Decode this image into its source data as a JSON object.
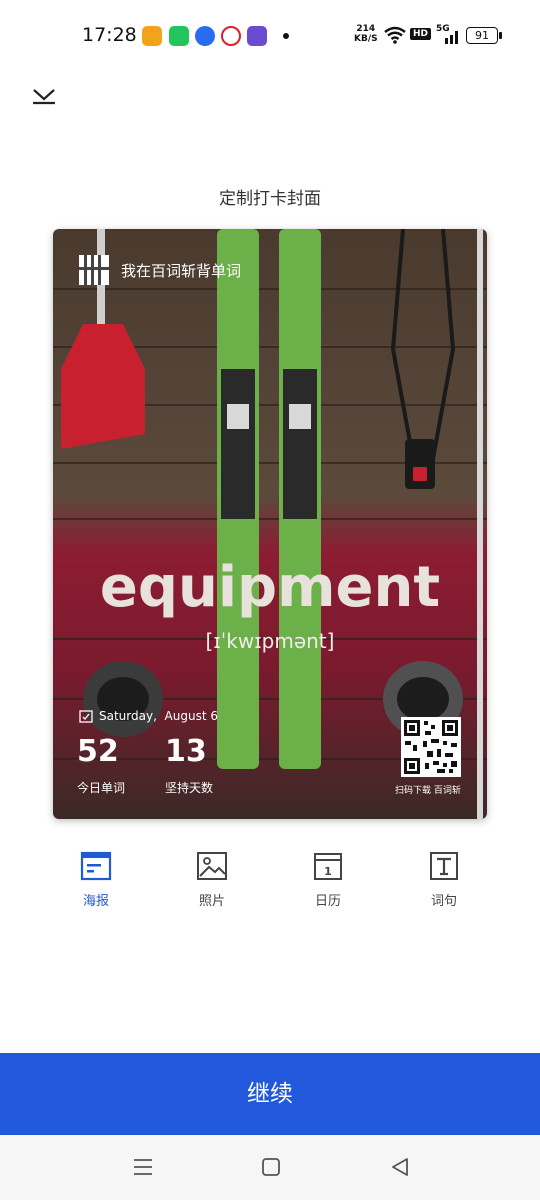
{
  "status_bar": {
    "time": "17:28",
    "network_speed": "214",
    "network_unit": "KB/S",
    "hd_badge": "HD",
    "network_type": "5G",
    "battery": "91"
  },
  "header": {
    "title": "定制打卡封面"
  },
  "card": {
    "brand": "我在百词斩背单词",
    "word": "equipment",
    "phonetic": "[ɪˈkwɪpmənt]",
    "date_day": "Saturday",
    "date_month_day": "August 6",
    "today_words_value": "52",
    "today_words_label": "今日单词",
    "streak_days_value": "13",
    "streak_days_label": "坚持天数",
    "qr_caption_prefix": "扫码下载",
    "qr_caption_brand": "百词斩"
  },
  "tabs": [
    {
      "label": "海报",
      "icon": "poster-icon",
      "active": true
    },
    {
      "label": "照片",
      "icon": "photo-icon",
      "active": false
    },
    {
      "label": "日历",
      "icon": "calendar-icon",
      "active": false
    },
    {
      "label": "词句",
      "icon": "text-icon",
      "active": false
    }
  ],
  "actions": {
    "continue_label": "继续"
  },
  "colors": {
    "accent": "#2158dc",
    "active_tab": "#1f5ad6"
  }
}
